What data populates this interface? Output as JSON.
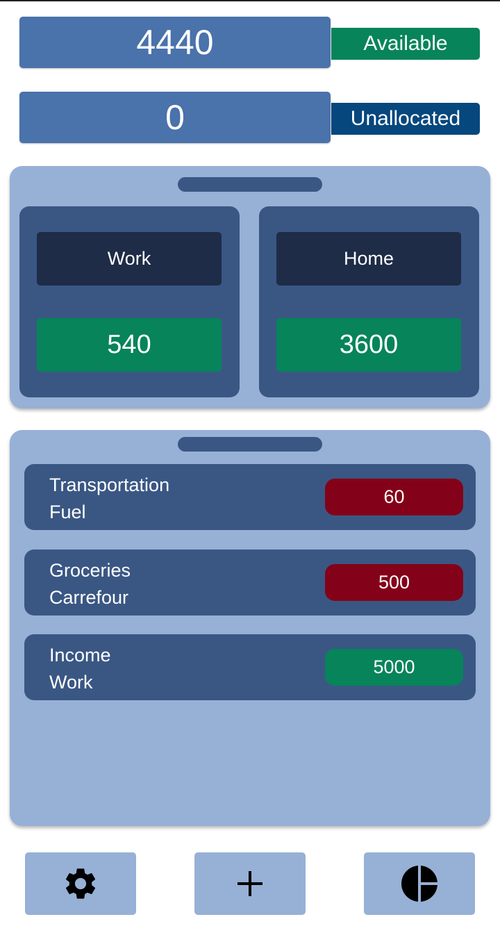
{
  "summary": {
    "available_value": "4440",
    "available_label": "Available",
    "unallocated_value": "0",
    "unallocated_label": "Unallocated"
  },
  "accounts": [
    {
      "name": "Work",
      "value": "540"
    },
    {
      "name": "Home",
      "value": "3600"
    }
  ],
  "transactions": [
    {
      "category": "Transportation",
      "note": "Fuel",
      "amount": "60",
      "kind": "expense"
    },
    {
      "category": "Groceries",
      "note": "Carrefour",
      "amount": "500",
      "kind": "expense"
    },
    {
      "category": "Income",
      "note": "Work",
      "amount": "5000",
      "kind": "income"
    }
  ],
  "nav": {
    "settings_icon": "gear-icon",
    "add_icon": "plus-icon",
    "chart_icon": "pie-chart-icon"
  },
  "colors": {
    "primary": "#4a72ab",
    "panel": "#97b0d6",
    "card": "#3a5784",
    "available": "#07845a",
    "unallocated": "#06477d",
    "expense": "#840219",
    "income": "#07845a"
  }
}
